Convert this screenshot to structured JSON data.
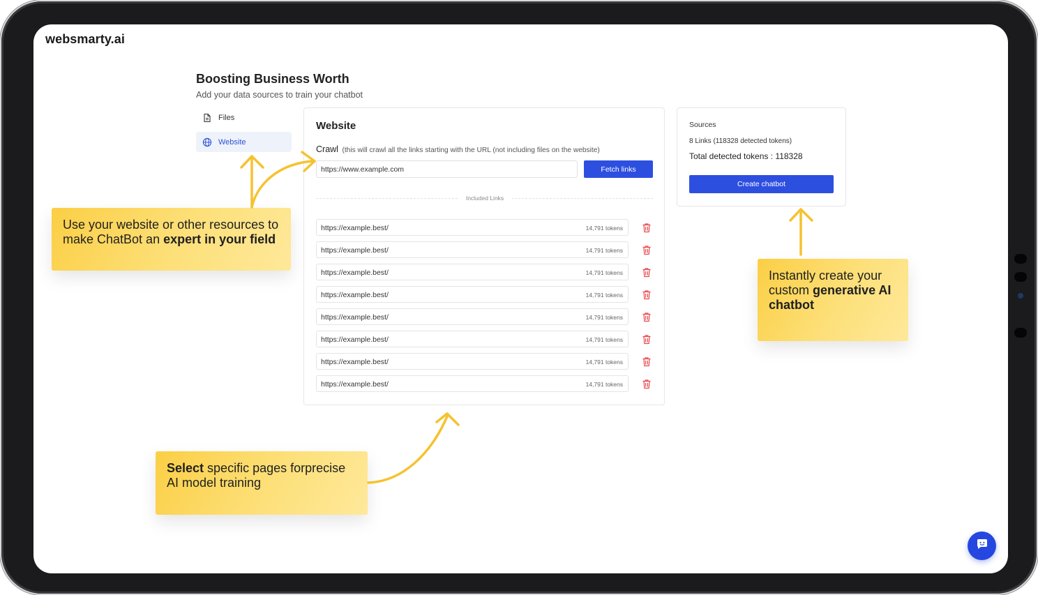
{
  "app": {
    "brand": "websmarty.ai"
  },
  "page": {
    "title": "Boosting Business Worth",
    "subtitle": "Add your data sources to train your chatbot"
  },
  "sidebar": {
    "items": [
      {
        "label": "Files",
        "icon": "file-icon"
      },
      {
        "label": "Website",
        "icon": "globe-icon",
        "active": true
      }
    ]
  },
  "website": {
    "title": "Website",
    "crawl_label": "Crawl",
    "crawl_hint": "(this will crawl all the links starting with the URL (not including files on the website)",
    "url_placeholder": "https://www.example.com",
    "fetch_label": "Fetch links",
    "included_links_label": "Included Links",
    "links": [
      {
        "url": "https://example.best/",
        "tokens": "14,791 tokens"
      },
      {
        "url": "https://example.best/",
        "tokens": "14,791 tokens"
      },
      {
        "url": "https://example.best/",
        "tokens": "14,791 tokens"
      },
      {
        "url": "https://example.best/",
        "tokens": "14,791 tokens"
      },
      {
        "url": "https://example.best/",
        "tokens": "14,791 tokens"
      },
      {
        "url": "https://example.best/",
        "tokens": "14,791 tokens"
      },
      {
        "url": "https://example.best/",
        "tokens": "14,791 tokens"
      },
      {
        "url": "https://example.best/",
        "tokens": "14,791 tokens"
      }
    ]
  },
  "sources": {
    "title": "Sources",
    "links_summary": "8 Links (118328 detected tokens)",
    "total_tokens": "Total detected tokens : 118328",
    "create_label": "Create chatbot"
  },
  "callouts": {
    "website": {
      "pre": "Use your website or other resources to make ChatBot an ",
      "bold": "expert in your field"
    },
    "create": {
      "pre": "Instantly create your custom ",
      "bold": "generative AI chatbot"
    },
    "select": {
      "bold": "Select",
      "post": " specific pages forprecise AI model training"
    }
  },
  "colors": {
    "accent": "#2d4fe0",
    "callout": "#fbcf45",
    "delete": "#e5484d",
    "arrow": "#f5c22f"
  }
}
